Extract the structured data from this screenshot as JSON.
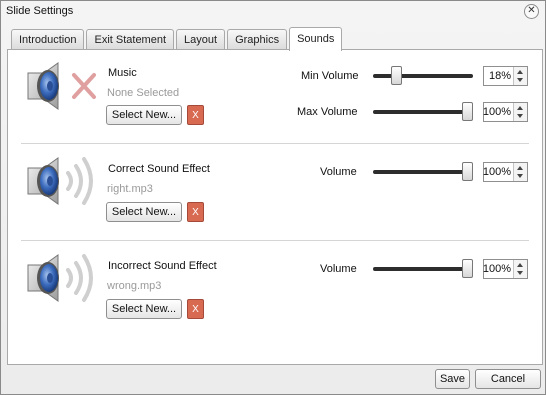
{
  "window": {
    "title": "Slide Settings"
  },
  "tabs": [
    "Introduction",
    "Exit Statement",
    "Layout",
    "Graphics",
    "Sounds"
  ],
  "active_tab": "Sounds",
  "music": {
    "label": "Music",
    "file": "None Selected",
    "select_label": "Select New...",
    "clear_label": "X",
    "min_volume": {
      "label": "Min Volume",
      "value": "18%",
      "level": 0.18
    },
    "max_volume": {
      "label": "Max Volume",
      "value": "100%",
      "level": 1.0
    }
  },
  "correct": {
    "label": "Correct Sound Effect",
    "file": "right.mp3",
    "select_label": "Select New...",
    "clear_label": "X",
    "volume": {
      "label": "Volume",
      "value": "100%",
      "level": 1.0
    }
  },
  "incorrect": {
    "label": "Incorrect Sound Effect",
    "file": "wrong.mp3",
    "select_label": "Select New...",
    "clear_label": "X",
    "volume": {
      "label": "Volume",
      "value": "100%",
      "level": 1.0
    }
  },
  "footer": {
    "save_label": "Save",
    "cancel_label": "Cancel"
  },
  "colors": {
    "clear_button": "#d86a52",
    "muted_x": "#e0a0a0",
    "slider_track": "#2d2d2d"
  },
  "icons": {
    "speaker": "speaker-icon",
    "muted": "muted-x-icon",
    "waves": "sound-waves-icon",
    "close": "close-icon"
  }
}
